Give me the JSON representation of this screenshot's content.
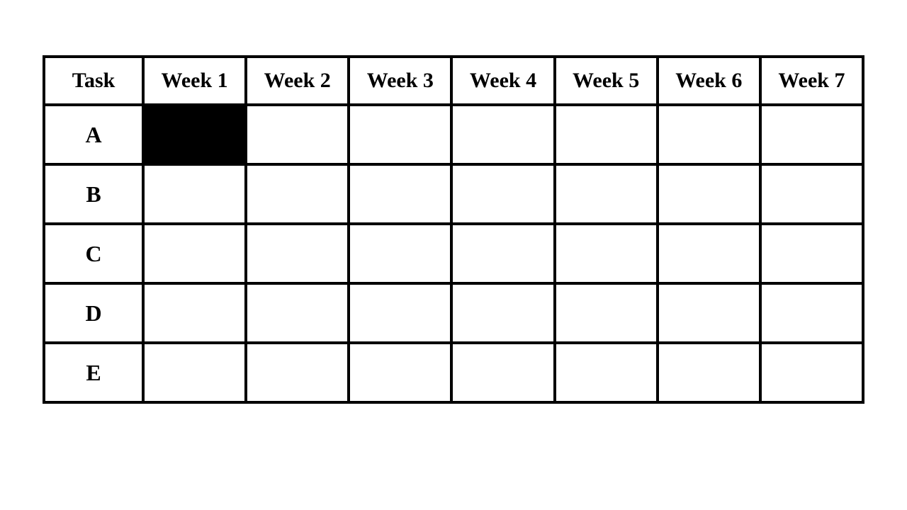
{
  "chart_data": {
    "type": "table",
    "title": "",
    "row_header_label": "Task",
    "weeks": [
      "Week 1",
      "Week 2",
      "Week 3",
      "Week 4",
      "Week 5",
      "Week 6",
      "Week 7"
    ],
    "tasks": [
      {
        "name": "A",
        "cells": [
          true,
          false,
          false,
          false,
          false,
          false,
          false
        ]
      },
      {
        "name": "B",
        "cells": [
          false,
          false,
          false,
          false,
          false,
          false,
          false
        ]
      },
      {
        "name": "C",
        "cells": [
          false,
          false,
          false,
          false,
          false,
          false,
          false
        ]
      },
      {
        "name": "D",
        "cells": [
          false,
          false,
          false,
          false,
          false,
          false,
          false
        ]
      },
      {
        "name": "E",
        "cells": [
          false,
          false,
          false,
          false,
          false,
          false,
          false
        ]
      }
    ]
  }
}
